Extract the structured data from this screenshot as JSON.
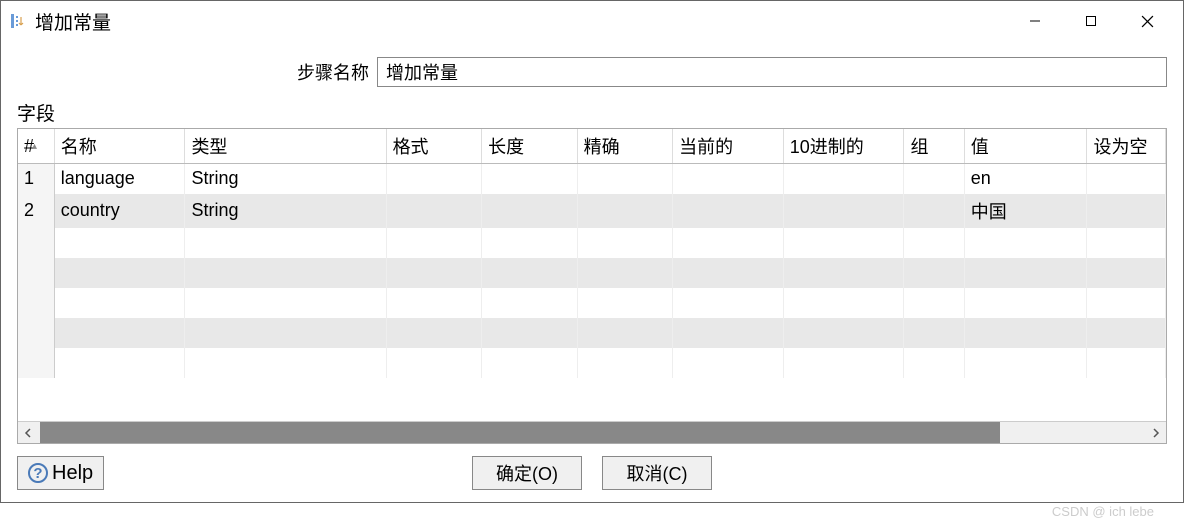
{
  "window": {
    "title": "增加常量"
  },
  "form": {
    "step_name_label": "步骤名称",
    "step_name_value": "增加常量",
    "section_label": "字段"
  },
  "table": {
    "headers": {
      "idx": "#",
      "name": "名称",
      "type": "类型",
      "format": "格式",
      "length": "长度",
      "precision": "精确",
      "current": "当前的",
      "decimal": "10进制的",
      "group": "组",
      "value": "值",
      "setnull": "设为空"
    },
    "rows": [
      {
        "idx": "1",
        "name": "language",
        "type": "String",
        "format": "",
        "length": "",
        "precision": "",
        "current": "",
        "decimal": "",
        "group": "",
        "value": "en",
        "setnull": ""
      },
      {
        "idx": "2",
        "name": "country",
        "type": "String",
        "format": "",
        "length": "",
        "precision": "",
        "current": "",
        "decimal": "",
        "group": "",
        "value": "中国",
        "setnull": ""
      }
    ]
  },
  "buttons": {
    "ok": "确定(O)",
    "cancel": "取消(C)",
    "help": "Help"
  },
  "watermark": "CSDN @ ich lebe"
}
